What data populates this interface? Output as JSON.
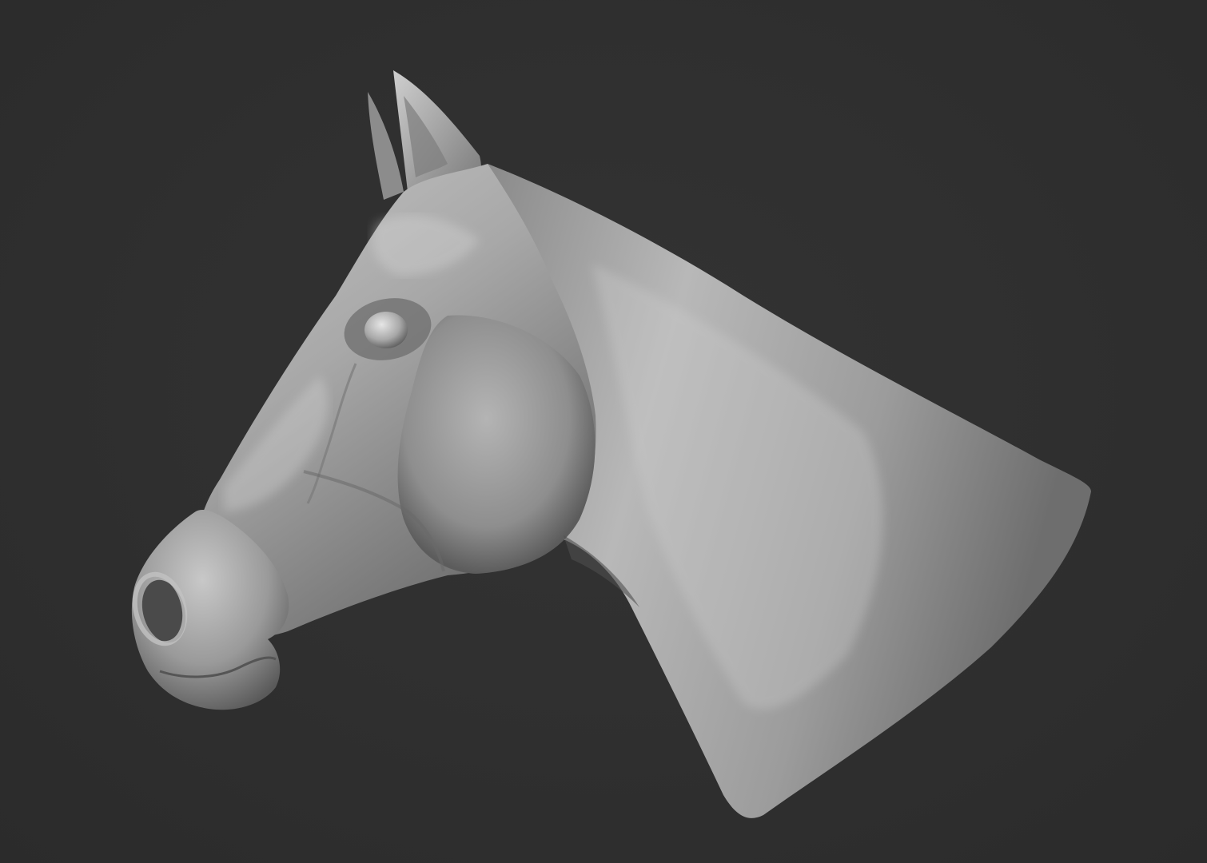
{
  "scene": {
    "subject": "horse-head-sculpt",
    "render_style": "matcap-grey-clay",
    "colors": {
      "background": "#2e2e2e",
      "sculpt_base": "#9a9a9a",
      "sculpt_highlight": "#d8d8d8",
      "sculpt_shadow": "#4a4a4a"
    }
  }
}
